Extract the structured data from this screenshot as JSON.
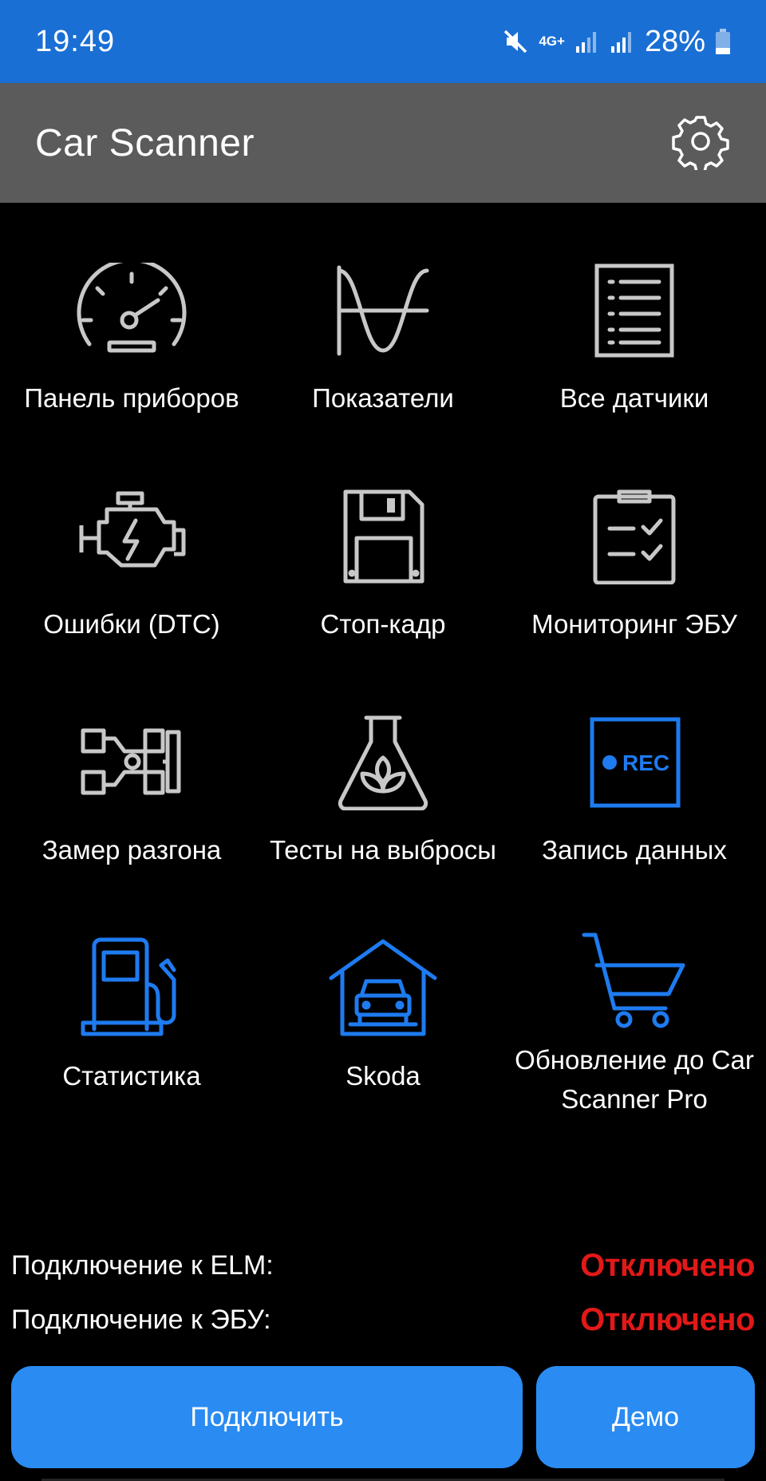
{
  "status_bar": {
    "time": "19:49",
    "network": "4G+",
    "battery": "28%"
  },
  "app_bar": {
    "title": "Car Scanner"
  },
  "menu": [
    {
      "label": "Панель приборов",
      "icon": "speedometer-icon",
      "color": "#c8c8c8"
    },
    {
      "label": "Показатели",
      "icon": "sine-wave-icon",
      "color": "#c8c8c8"
    },
    {
      "label": "Все датчики",
      "icon": "list-document-icon",
      "color": "#c8c8c8"
    },
    {
      "label": "Ошибки (DTC)",
      "icon": "check-engine-icon",
      "color": "#c8c8c8"
    },
    {
      "label": "Стоп-кадр",
      "icon": "floppy-disk-icon",
      "color": "#c8c8c8"
    },
    {
      "label": "Мониторинг ЭБУ",
      "icon": "clipboard-check-icon",
      "color": "#c8c8c8"
    },
    {
      "label": "Замер разгона",
      "icon": "race-car-icon",
      "color": "#c8c8c8"
    },
    {
      "label": "Тесты на выбросы",
      "icon": "eco-flask-icon",
      "color": "#c8c8c8"
    },
    {
      "label": "Запись данных",
      "icon": "rec-icon",
      "color": "#1e7bf0",
      "rec_text": "REC"
    },
    {
      "label": "Статистика",
      "icon": "fuel-pump-icon",
      "color": "#1e7bf0"
    },
    {
      "label": "Skoda",
      "icon": "garage-icon",
      "color": "#1e7bf0"
    },
    {
      "label": "Обновление до Car Scanner Pro",
      "icon": "shopping-cart-icon",
      "color": "#1e7bf0"
    }
  ],
  "connection": {
    "elm_label": "Подключение к ELM:",
    "elm_status": "Отключено",
    "ecu_label": "Подключение к ЭБУ:",
    "ecu_status": "Отключено",
    "status_color": "#e31818"
  },
  "buttons": {
    "connect": "Подключить",
    "demo": "Демо"
  },
  "colors": {
    "status_bar": "#1a6fd4",
    "app_bar": "#5b5b5b",
    "button": "#2a8bf2"
  }
}
